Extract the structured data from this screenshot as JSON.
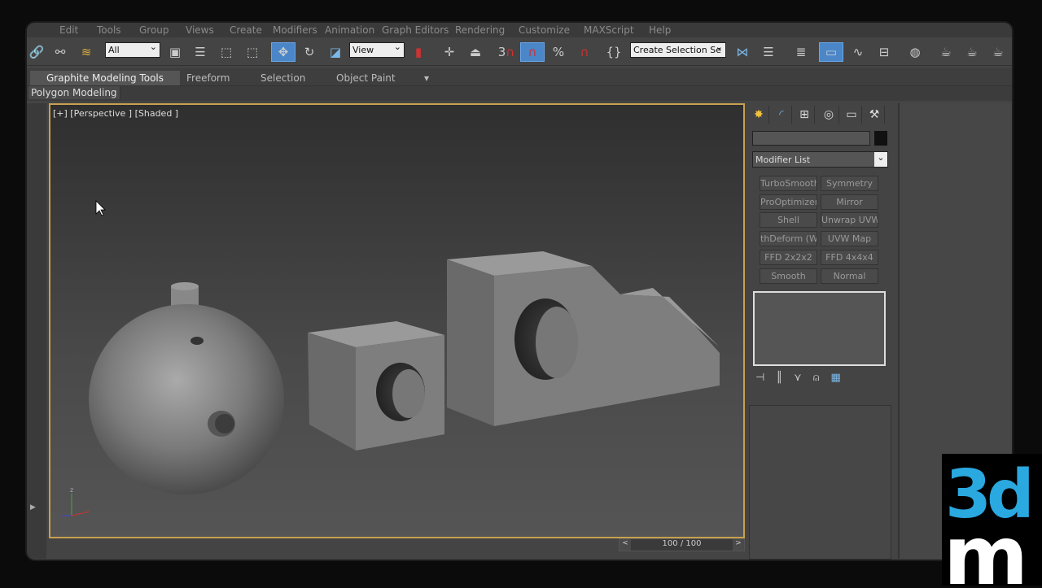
{
  "menu": [
    "Edit",
    "Tools",
    "Group",
    "Views",
    "Create",
    "Modifiers",
    "Animation",
    "Graph Editors",
    "Rendering",
    "Customize",
    "MAXScript",
    "Help"
  ],
  "toolbar": {
    "selection_filter": "All",
    "ref_coord": "View",
    "snap_label": "3",
    "named_selection": "Create Selection Se"
  },
  "ribbon": {
    "tabs": [
      "Graphite Modeling Tools",
      "Freeform",
      "Selection",
      "Object Paint"
    ],
    "sub_panel": "Polygon Modeling"
  },
  "viewport": {
    "label": "[+] [Perspective ] [Shaded ]",
    "axis": "z"
  },
  "time_slider": {
    "value": "100 / 100",
    "prev": "<",
    "next": ">"
  },
  "command_panel": {
    "modifier_list": "Modifier List",
    "buttons": [
      "TurboSmooth",
      "Symmetry",
      "ProOptimizer",
      "Mirror",
      "Shell",
      "Unwrap UVW",
      "thDeform (WSI",
      "UVW Map",
      "FFD 2x2x2",
      "FFD 4x4x4",
      "Smooth",
      "Normal"
    ]
  },
  "logo": "3dm",
  "colors": {
    "accent": "#4a86c8",
    "viewport_border": "#c8a050",
    "logo_blue": "#2aa8e0"
  }
}
